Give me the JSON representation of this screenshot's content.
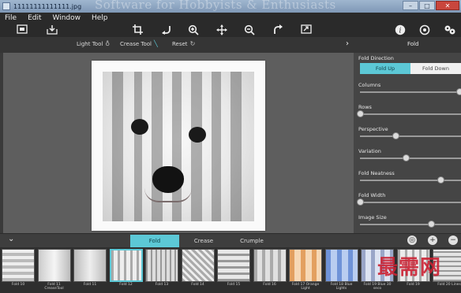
{
  "window": {
    "title": "11111111111111.jpg",
    "bg_title_text": "Software for Hobbyists & Enthusiasts",
    "controls": [
      "–",
      "□",
      "✕"
    ]
  },
  "menu": [
    "File",
    "Edit",
    "Window",
    "Help"
  ],
  "toolbar": {
    "left_icons": [
      "fit-screen-icon",
      "save-icon"
    ],
    "center_icons": [
      "crop-icon",
      "undo-icon",
      "zoom-in-icon",
      "move-icon",
      "zoom-out-icon",
      "redo-icon",
      "export-icon"
    ],
    "right_icons": [
      "info-icon",
      "settings-icon",
      "effects-icon"
    ]
  },
  "subtoolbar": {
    "light_tool": "Light Tool",
    "crease_tool": "Crease Tool",
    "reset": "Reset",
    "panel_title": "Fold"
  },
  "panel": {
    "fold_direction_label": "Fold Direction",
    "fold_up": "Fold Up",
    "fold_down": "Fold Down",
    "sliders": [
      {
        "label": "Columns",
        "value": 1.0
      },
      {
        "label": "Rows",
        "value": 0.0
      },
      {
        "label": "Perspective",
        "value": 0.35
      },
      {
        "label": "Variation",
        "value": 0.45
      },
      {
        "label": "Fold Neatness",
        "value": 0.8
      },
      {
        "label": "Fold Width",
        "value": 0.0
      },
      {
        "label": "Image Size",
        "value": 0.7
      }
    ]
  },
  "tabs": [
    "Fold",
    "Crease",
    "Crumple"
  ],
  "active_tab": "Fold",
  "thumbnails": [
    {
      "label": "Fold 10"
    },
    {
      "label": "Fold 11 CreaseTool"
    },
    {
      "label": "Fold 11"
    },
    {
      "label": "Fold 12"
    },
    {
      "label": "Fold 13"
    },
    {
      "label": "Fold 14"
    },
    {
      "label": "Fold 15"
    },
    {
      "label": "Fold 16"
    },
    {
      "label": "Fold 17 Orange Light"
    },
    {
      "label": "Fold 18 Blue Lights"
    },
    {
      "label": "Fold 19 Blue 30 seco"
    },
    {
      "label": "Fold 19"
    },
    {
      "label": "Fold 20 Lines"
    }
  ],
  "selected_thumbnail": 3,
  "bottom_watermark": "最需网",
  "colors": {
    "accent": "#5cc8d6"
  }
}
